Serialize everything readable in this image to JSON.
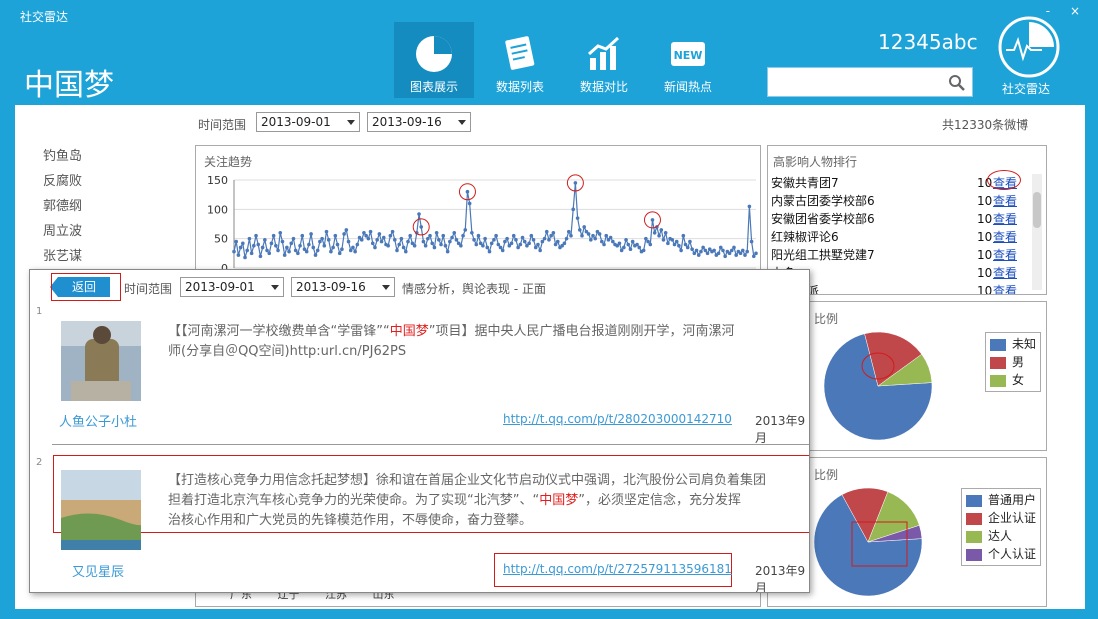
{
  "app": {
    "title": "社交雷达",
    "window_controls": "- ×",
    "brand": "中国梦",
    "user": "12345abc",
    "logo_label": "社交雷达"
  },
  "nav": [
    {
      "label": "图表展示",
      "icon": "pie-chart-icon",
      "active": true
    },
    {
      "label": "数据列表",
      "icon": "document-list-icon",
      "active": false
    },
    {
      "label": "数据对比",
      "icon": "bar-trend-icon",
      "active": false
    },
    {
      "label": "新闻热点",
      "icon": "new-badge-icon",
      "active": false
    }
  ],
  "new_badge_text": "NEW",
  "search": {
    "placeholder": ""
  },
  "filter": {
    "label": "时间范围",
    "start": "2013-09-01",
    "end": "2013-09-16",
    "total": "共12330条微博"
  },
  "keywords": [
    "钓鱼岛",
    "反腐败",
    "郭德纲",
    "周立波",
    "张艺谋"
  ],
  "trend": {
    "title": "关注趋势",
    "chart_data": {
      "type": "line",
      "title": "关注趋势",
      "ylim": [
        0,
        150
      ],
      "yticks": [
        "150",
        "100",
        "50",
        "0"
      ],
      "values": [
        28,
        45,
        22,
        35,
        42,
        18,
        30,
        50,
        25,
        38,
        55,
        40,
        20,
        35,
        48,
        30,
        25,
        42,
        55,
        38,
        30,
        60,
        45,
        22,
        35,
        28,
        42,
        50,
        30,
        25,
        38,
        55,
        32,
        28,
        40,
        58,
        35,
        22,
        30,
        45,
        50,
        38,
        62,
        48,
        28,
        35,
        55,
        40,
        25,
        32,
        58,
        65,
        45,
        30,
        35,
        28,
        40,
        52,
        48,
        60,
        55,
        50,
        62,
        42,
        35,
        48,
        58,
        45,
        52,
        40,
        38,
        55,
        62,
        48,
        30,
        40,
        50,
        35,
        28,
        45,
        55,
        42,
        38,
        60,
        92,
        70,
        45,
        38,
        50,
        55,
        42,
        35,
        60,
        48,
        40,
        55,
        38,
        28,
        45,
        52,
        60,
        48,
        42,
        38,
        55,
        65,
        130,
        110,
        60,
        48,
        40,
        55,
        42,
        38,
        50,
        35,
        28,
        42,
        48,
        55,
        40,
        35,
        30,
        45,
        50,
        38,
        42,
        55,
        48,
        35,
        40,
        52,
        45,
        38,
        42,
        55,
        48,
        35,
        40,
        30,
        45,
        50,
        62,
        48,
        55,
        60,
        40,
        45,
        35,
        38,
        42,
        50,
        62,
        55,
        100,
        145,
        85,
        65,
        55,
        70,
        62,
        58,
        48,
        55,
        50,
        62,
        58,
        45,
        40,
        55,
        48,
        52,
        45,
        40,
        38,
        42,
        30,
        35,
        48,
        40,
        32,
        45,
        38,
        40,
        35,
        28,
        30,
        50,
        45,
        40,
        82,
        60,
        70,
        55,
        65,
        48,
        60,
        42,
        50,
        48,
        40,
        45,
        38,
        30,
        55,
        40,
        35,
        45,
        32,
        25,
        30,
        22,
        28,
        35,
        30,
        25,
        32,
        28,
        30,
        22,
        25,
        35,
        30,
        20,
        28,
        25,
        30,
        35,
        22,
        28,
        25,
        30,
        22,
        28,
        105,
        45,
        20,
        25
      ]
    }
  },
  "ranking": {
    "title": "高影响人物排行",
    "rows": [
      {
        "name": "安徽共青团7",
        "count": "10",
        "link": "查看"
      },
      {
        "name": "内蒙古团委学校部6",
        "count": "10",
        "link": "查看"
      },
      {
        "name": "安徽团省委学校部6",
        "count": "10",
        "link": "查看"
      },
      {
        "name": "红辣椒评论6",
        "count": "10",
        "link": "查看"
      },
      {
        "name": "阳光组工拱墅党建7",
        "count": "10",
        "link": "查看"
      },
      {
        "name": "大多",
        "count": "10",
        "link": "查看"
      },
      {
        "name": "艺文流派",
        "count": "10",
        "link": "查看"
      }
    ]
  },
  "gender": {
    "title_fragment": "比例",
    "legend": [
      "未知",
      "男",
      "女"
    ],
    "colors": [
      "#4a78b8",
      "#c0474a",
      "#97b853"
    ],
    "chart_data": {
      "type": "pie",
      "categories": [
        "未知",
        "男",
        "女"
      ],
      "values": [
        72,
        19,
        9
      ]
    }
  },
  "usertype": {
    "title_fragment": "比例",
    "legend": [
      "普通用户",
      "企业认证",
      "达人",
      "个人认证"
    ],
    "colors": [
      "#4a78b8",
      "#c0474a",
      "#97b853",
      "#7a5aa8"
    ],
    "chart_data": {
      "type": "pie",
      "categories": [
        "普通用户",
        "企业认证",
        "达人",
        "个人认证"
      ],
      "values": [
        68,
        14,
        14,
        4
      ]
    }
  },
  "bottom_labels": [
    "广东",
    "辽宁",
    "江苏",
    "山东"
  ],
  "overlay": {
    "back_label": "返回",
    "filter_label": "时间范围",
    "start": "2013-09-01",
    "end": "2013-09-16",
    "context": "情感分析，舆论表现 - 正面",
    "posts": [
      {
        "index": "1",
        "author": "人鱼公子小杜",
        "line1_pre": "【【河南漯河一学校缴费单含“学雷锋”“",
        "line1_hl": "中国梦",
        "line1_post": "”项目】据中央人民广播电台报道刚刚开学，河南漯河",
        "line2": "师(分享自＠QQ空间)http:url.cn/PJ62PS",
        "url": "http://t.qq.com/p/t/280203000142710",
        "time": "2013年9月"
      },
      {
        "index": "2",
        "author": "又见星辰",
        "line1": "【打造核心竞争力用信念托起梦想】徐和谊在首届企业文化节启动仪式中强调，北汽股份公司肩负着集团",
        "line2_pre": "担着打造北京汽车核心竞争力的光荣使命。为了实现“北汽梦”、“",
        "line2_hl": "中国梦",
        "line2_post": "”，必须坚定信念，充分发挥",
        "line3": "治核心作用和广大党员的先锋模范作用，不辱使命，奋力登攀。",
        "url": "http://t.qq.com/p/t/272579113596181",
        "time": "2013年9月"
      }
    ]
  }
}
